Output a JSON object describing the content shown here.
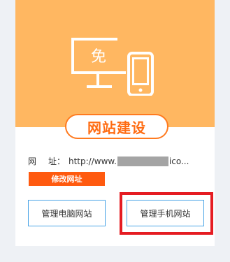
{
  "hero": {
    "icon_char": "免",
    "title": "网站建设"
  },
  "address": {
    "label_first": "网",
    "label_last": "址：",
    "url_prefix": "http://www.",
    "url_suffix": "ico..."
  },
  "buttons": {
    "modify": "修改网址",
    "manage_pc": "管理电脑网站",
    "manage_mobile": "管理手机网站"
  },
  "colors": {
    "hero_bg": "#ffb761",
    "accent_orange": "#ff6c12",
    "button_border": "#4aa4e6",
    "highlight_red": "#e51c22"
  }
}
